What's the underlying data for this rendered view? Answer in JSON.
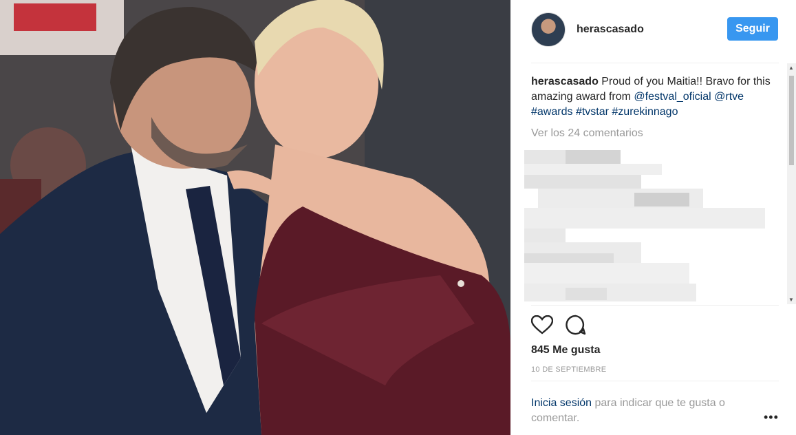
{
  "post": {
    "username": "herascasado",
    "follow_label": "Seguir",
    "caption": {
      "username": "herascasado",
      "text": " Proud of you Maitia!! Bravo for this amazing award from ",
      "mention": "@festval_oficial",
      "tags": [
        "@rtve",
        "#awards",
        "#tvstar",
        "#zurekinnago"
      ]
    },
    "view_comments": "Ver los 24 comentarios",
    "likes": "845 Me gusta",
    "date": "10 DE SEPTIEMBRE",
    "login_link": "Inicia sesión",
    "login_text": " para indicar que te gusta o comentar.",
    "more_label": "•••"
  },
  "icons": {
    "like": "heart-icon",
    "comment": "comment-icon",
    "more": "more-options-icon"
  },
  "colors": {
    "accent": "#3897f0",
    "link": "#003569",
    "muted": "#999999"
  }
}
